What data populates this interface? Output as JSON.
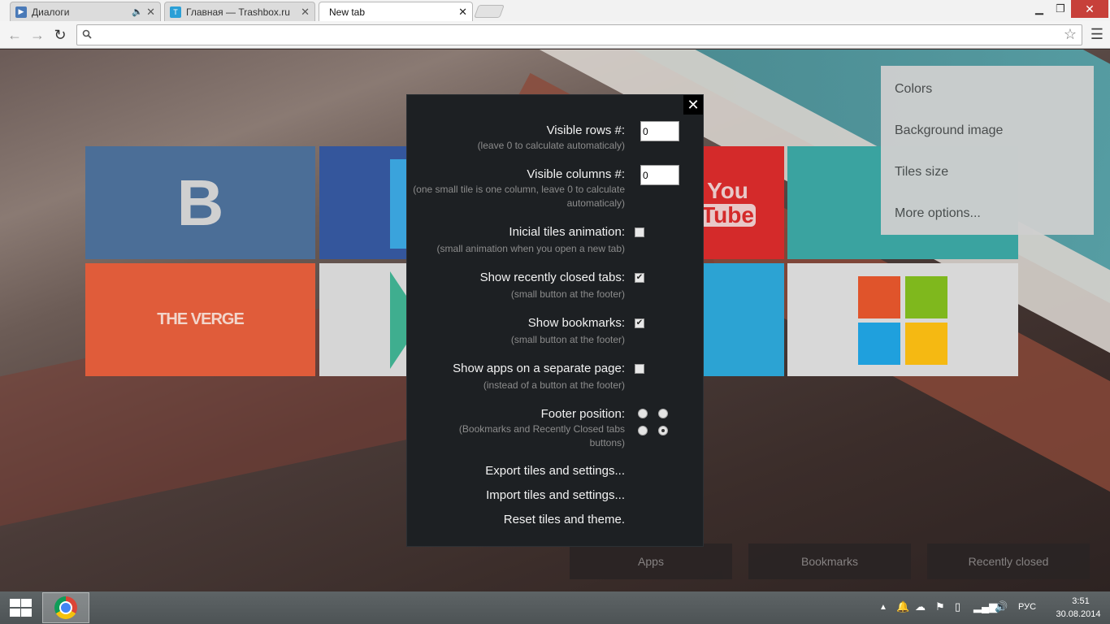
{
  "tabs": [
    {
      "title": "Диалоги",
      "favicon": "play-icon",
      "color": "#4a7ab8"
    },
    {
      "title": "Главная — Trashbox.ru",
      "favicon": "trashbox-icon",
      "color": "#2a9fd6"
    },
    {
      "title": "New tab"
    }
  ],
  "omnibox": {
    "value": "",
    "placeholder": ""
  },
  "tiles": {
    "vk": "B",
    "youtube_you": "You",
    "youtube_tube": "Tube",
    "verge": "THE VERGE"
  },
  "side_menu": [
    "Colors",
    "Background image",
    "Tiles size",
    "More options..."
  ],
  "settings": {
    "visible_rows": {
      "label": "Visible rows #:",
      "hint": "(leave 0 to calculate automaticaly)",
      "value": "0"
    },
    "visible_columns": {
      "label": "Visible columns #:",
      "hint": "(one small tile is one column, leave 0 to calculate automaticaly)",
      "value": "0"
    },
    "animation": {
      "label": "Inicial tiles animation:",
      "hint": "(small animation when you open a new tab)",
      "checked": false
    },
    "recently_closed": {
      "label": "Show recently closed tabs:",
      "hint": "(small button at the footer)",
      "checked": true
    },
    "bookmarks": {
      "label": "Show bookmarks:",
      "hint": "(small button at the footer)",
      "checked": true
    },
    "apps_page": {
      "label": "Show apps on a separate page:",
      "hint": "(instead of a button at the footer)",
      "checked": false
    },
    "footer_position": {
      "label": "Footer position:",
      "hint": "(Bookmarks and Recently Closed tabs buttons)",
      "selected": "bottom-right"
    },
    "export": "Export tiles and settings...",
    "import": "Import tiles and settings...",
    "reset": "Reset tiles and theme."
  },
  "footer": {
    "apps": "Apps",
    "bookmarks": "Bookmarks",
    "recently_closed": "Recently closed"
  },
  "taskbar": {
    "lang": "РУС",
    "time": "3:51",
    "date": "30.08.2014"
  }
}
